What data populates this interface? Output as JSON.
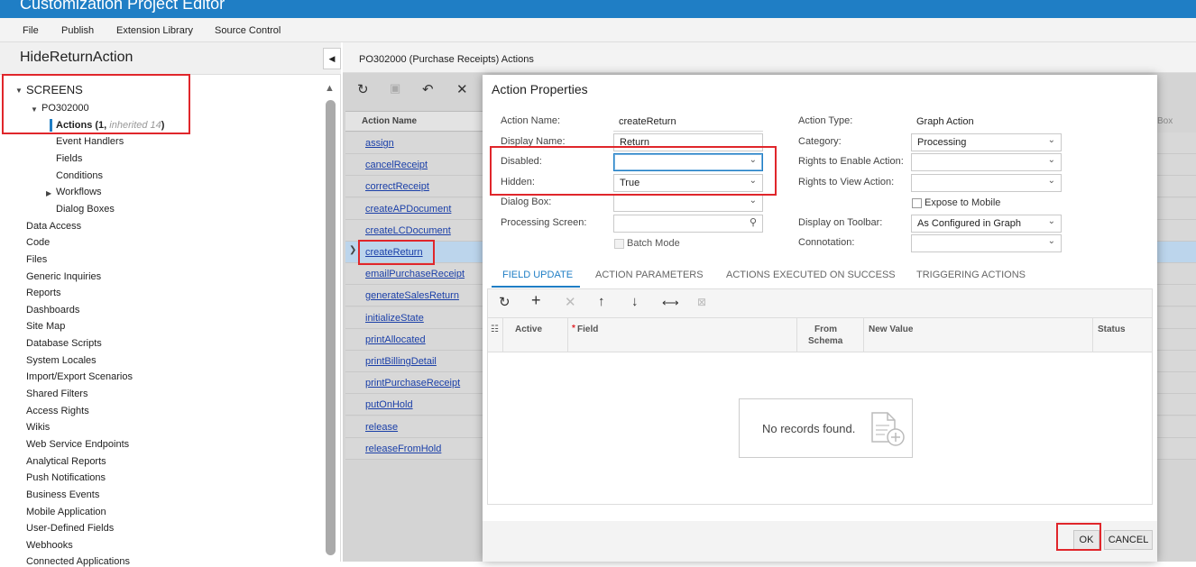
{
  "window": {
    "title": "Customization Project Editor"
  },
  "menu": {
    "items": [
      "File",
      "Publish",
      "Extension Library",
      "Source Control"
    ]
  },
  "project": {
    "name": "HideReturnAction"
  },
  "tree": {
    "screens_label": "SCREENS",
    "screen_id": "PO302000",
    "actions_label": "Actions (1,",
    "actions_inherited": "inherited 14",
    "actions_close": ")",
    "screen_children": [
      "Event Handlers",
      "Fields",
      "Conditions",
      "Workflows",
      "Dialog Boxes"
    ],
    "root_items": [
      "Data Access",
      "Code",
      "Files",
      "Generic Inquiries",
      "Reports",
      "Dashboards",
      "Site Map",
      "Database Scripts",
      "System Locales",
      "Import/Export Scenarios",
      "Shared Filters",
      "Access Rights",
      "Wikis",
      "Web Service Endpoints",
      "Analytical Reports",
      "Push Notifications",
      "Business Events",
      "Mobile Application",
      "User-Defined Fields",
      "Webhooks",
      "Connected Applications"
    ]
  },
  "panel": {
    "title": "PO302000 (Purchase Receipts) Actions"
  },
  "grid": {
    "header": "Action Name",
    "right_header_fragment": "Box",
    "selected_index": 5,
    "actions": [
      "assign",
      "cancelReceipt",
      "correctReceipt",
      "createAPDocument",
      "createLCDocument",
      "createReturn",
      "emailPurchaseReceipt",
      "generateSalesReturn",
      "initializeState",
      "printAllocated",
      "printBillingDetail",
      "printPurchaseReceipt",
      "putOnHold",
      "release",
      "releaseFromHold"
    ]
  },
  "dialog": {
    "title": "Action Properties",
    "action_name_label": "Action Name:",
    "action_name_value": "createReturn",
    "display_name_label": "Display Name:",
    "display_name_value": "Return",
    "disabled_label": "Disabled:",
    "disabled_value": "",
    "hidden_label": "Hidden:",
    "hidden_value": "True",
    "dialog_box_label": "Dialog Box:",
    "dialog_box_value": "",
    "processing_screen_label": "Processing Screen:",
    "processing_screen_value": "",
    "batch_mode_label": "Batch Mode",
    "action_type_label": "Action Type:",
    "action_type_value": "Graph Action",
    "category_label": "Category:",
    "category_value": "Processing",
    "rights_enable_label": "Rights to Enable Action:",
    "rights_enable_value": "",
    "rights_view_label": "Rights to View Action:",
    "rights_view_value": "",
    "expose_mobile_label": "Expose to Mobile",
    "display_toolbar_label": "Display on Toolbar:",
    "display_toolbar_value": "As Configured in Graph",
    "connotation_label": "Connotation:",
    "connotation_value": "",
    "tabs": [
      "FIELD UPDATE",
      "ACTION PARAMETERS",
      "ACTIONS EXECUTED ON SUCCESS",
      "TRIGGERING ACTIONS"
    ],
    "columns": {
      "active": "Active",
      "field": "Field",
      "from1": "From",
      "from2": "Schema",
      "new_value": "New Value",
      "status": "Status"
    },
    "required_mark": "*",
    "empty_text": "No records found.",
    "ok_label": "OK",
    "cancel_label": "CANCEL"
  },
  "colors": {
    "accent": "#1f7ec5",
    "highlight": "#e0262b",
    "link": "#1a3fa8"
  }
}
